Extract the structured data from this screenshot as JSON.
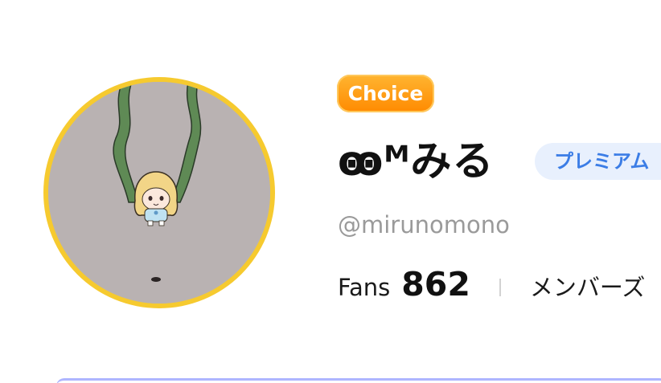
{
  "profile": {
    "badge_label": "Choice",
    "display_name": "ꙭᴹみる",
    "membership_badge": "プレミアム",
    "handle": "@mirunomono",
    "stats": {
      "fans_label": "Fans",
      "fans_count": "862",
      "member_label": "メンバーズ"
    }
  },
  "colors": {
    "avatar_ring": "#f6ca2f",
    "avatar_bg": "#b9b2b2",
    "choice_badge": "#ff9a10",
    "premium_text": "#3b7de6",
    "premium_bg": "#e8f0fd",
    "handle_text": "#9a9a9a"
  }
}
